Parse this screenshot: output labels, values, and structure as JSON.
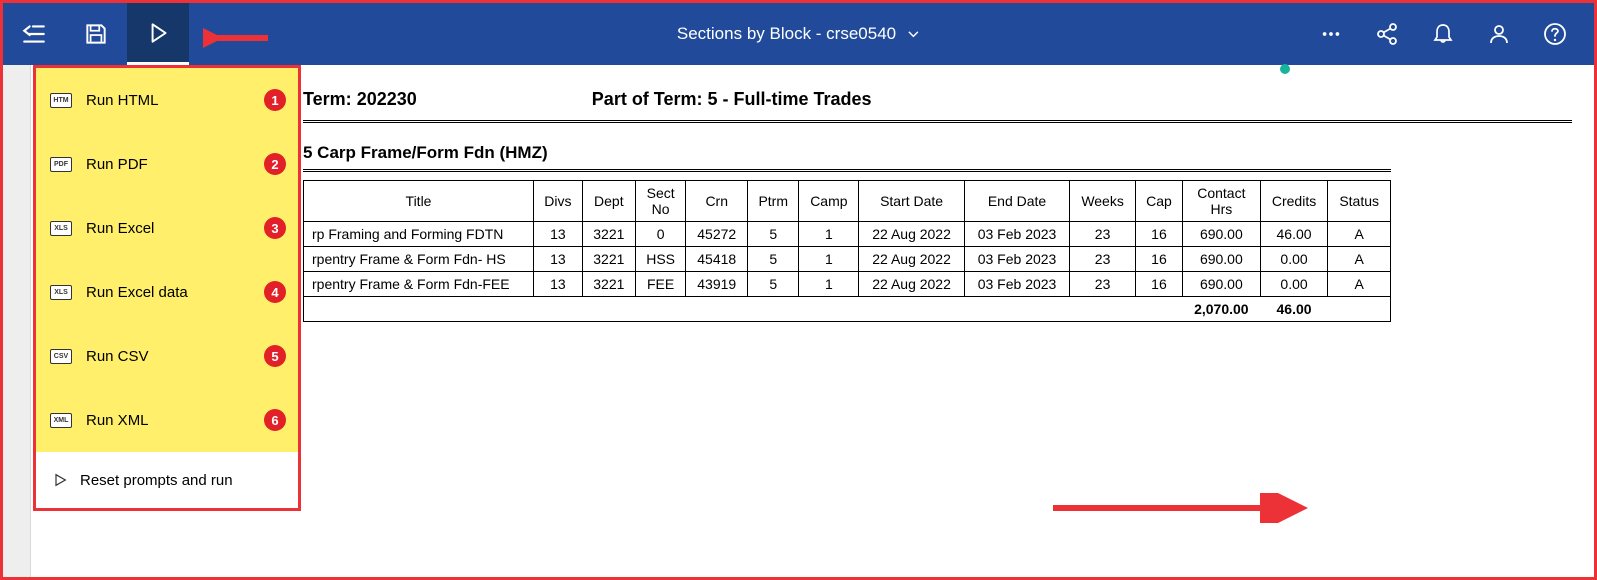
{
  "header": {
    "title": "Sections by Block - crse0540"
  },
  "runMenu": {
    "items": [
      {
        "badge": "HTM",
        "label": "Run HTML",
        "num": "1"
      },
      {
        "badge": "PDF",
        "label": "Run PDF",
        "num": "2"
      },
      {
        "badge": "XLS",
        "label": "Run Excel",
        "num": "3"
      },
      {
        "badge": "XLS",
        "label": "Run Excel data",
        "num": "4"
      },
      {
        "badge": "CSV",
        "label": "Run CSV",
        "num": "5"
      },
      {
        "badge": "XML",
        "label": "Run XML",
        "num": "6"
      }
    ],
    "reset": "Reset prompts and run"
  },
  "report": {
    "termLabel": "Term:",
    "termValue": "202230",
    "potLabel": "Part of Term:",
    "potValue": "5 - Full-time Trades",
    "blockTitle": "5 Carp Frame/Form Fdn (HMZ)",
    "columns": [
      "Title",
      "Divs",
      "Dept",
      "Sect No",
      "Crn",
      "Ptrm",
      "Camp",
      "Start Date",
      "End Date",
      "Weeks",
      "Cap",
      "Contact Hrs",
      "Credits",
      "Status"
    ],
    "rows": [
      {
        "title": "rp Framing and Forming FDTN",
        "divs": "13",
        "dept": "3221",
        "sect": "0",
        "crn": "45272",
        "ptrm": "5",
        "camp": "1",
        "start": "22 Aug 2022",
        "end": "03 Feb 2023",
        "weeks": "23",
        "cap": "16",
        "contact": "690.00",
        "credits": "46.00",
        "status": "A"
      },
      {
        "title": "rpentry Frame & Form Fdn- HS",
        "divs": "13",
        "dept": "3221",
        "sect": "HSS",
        "crn": "45418",
        "ptrm": "5",
        "camp": "1",
        "start": "22 Aug 2022",
        "end": "03 Feb 2023",
        "weeks": "23",
        "cap": "16",
        "contact": "690.00",
        "credits": "0.00",
        "status": "A"
      },
      {
        "title": "rpentry Frame & Form Fdn-FEE",
        "divs": "13",
        "dept": "3221",
        "sect": "FEE",
        "crn": "43919",
        "ptrm": "5",
        "camp": "1",
        "start": "22 Aug 2022",
        "end": "03 Feb 2023",
        "weeks": "23",
        "cap": "16",
        "contact": "690.00",
        "credits": "0.00",
        "status": "A"
      }
    ],
    "totals": {
      "contact": "2,070.00",
      "credits": "46.00"
    }
  }
}
